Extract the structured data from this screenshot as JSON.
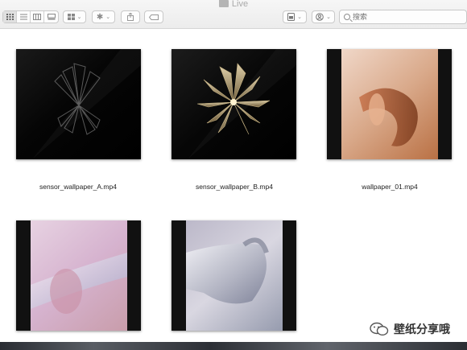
{
  "window": {
    "title": "Live"
  },
  "toolbar": {
    "view_buttons": [
      "icon-view",
      "list-view",
      "column-view",
      "gallery-view"
    ],
    "group_icon": "group-grid-icon",
    "action_icon": "gear-icon",
    "share_icon": "share-icon",
    "tag_icon": "tag-icon",
    "preview_icon": "quicklook-icon",
    "account_icon": "account-icon",
    "search_placeholder": "搜索"
  },
  "files": [
    {
      "name": "sensor_wallpaper_A.mp4"
    },
    {
      "name": "sensor_wallpaper_B.mp4"
    },
    {
      "name": "wallpaper_01.mp4"
    },
    {
      "name": ""
    },
    {
      "name": ""
    }
  ],
  "watermark": {
    "text": "壁纸分享哦"
  }
}
